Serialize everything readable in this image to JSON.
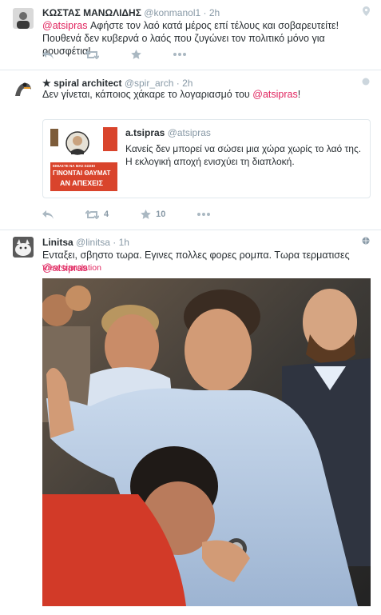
{
  "tweets": [
    {
      "name": "ΚΩΣΤΑΣ ΜΑΝΩΛΙΔΗΣ",
      "handle": "@konmanol1",
      "dot": "·",
      "time": "2h",
      "mention": "@atsipras",
      "text": " Αφήστε τον λαό κατά μέρος επί τέλους και σοβαρευτείτε! Πουθενά δεν κυβερνά ο λαός που ζυγώνει τον πολιτικό μόνο για ρουσφέτια!"
    },
    {
      "star": "★",
      "name": "spiral architect",
      "handle": "@spir_arch",
      "dot": "·",
      "time": "2h",
      "text_before": "Δεν γίνεται, κάποιος χάκαρε το λογαριασμό του ",
      "mention": "@atsipras",
      "text_after": "!",
      "retweets": "4",
      "likes": "10",
      "quote": {
        "name": "a.tsipras",
        "handle": "@atsipras",
        "text": "Κανείς δεν μπορεί να σώσει μια χώρα χωρίς το λαό της. Η εκλογική αποχή ενισχύει τη διαπλοκή.",
        "thumb_lines": [
          "ΕΙΜΑΣΤΕ ΝΑ ΜΑΣ ΣΩΣΕΙ",
          "ΓΙΝΟΝΤΑΙ ΘΑΥΜΑΤ",
          "ΑΝ ΑΠΕΧΕΙΣ"
        ]
      }
    },
    {
      "name": "Linitsa",
      "handle": "@linitsa",
      "dot": "·",
      "time": "1h",
      "text": "Ενταξει, σβηστο τωρα. Εγινες πολλες φορες ρομπα. Τωρα τερματισες ",
      "mention": "@atsipras",
      "translation": "View translation"
    }
  ],
  "icons": {
    "reply": "reply-icon",
    "retweet": "retweet-icon",
    "like": "star-icon",
    "more": "more-icon"
  },
  "colors": {
    "mention": "#e0245e",
    "muted": "#8899a6",
    "border": "#e1e8ed"
  }
}
